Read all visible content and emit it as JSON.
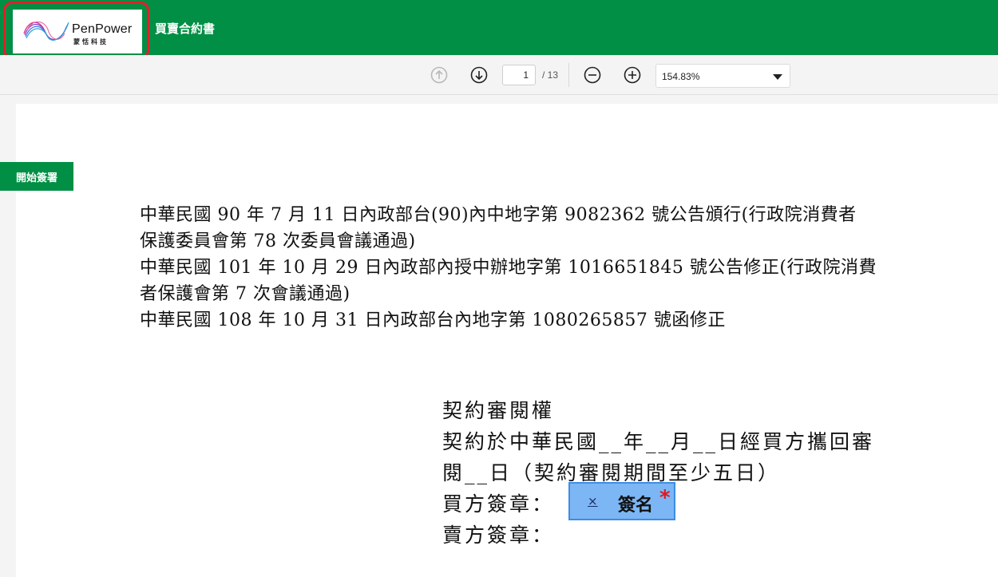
{
  "app": {
    "logo_word": "PenPower",
    "logo_sub": "蒙恬科技",
    "document_title": "買賣合約書",
    "brand_color": "#008f44",
    "highlight_color": "#e41e2b"
  },
  "toolbar": {
    "prev_icon": "arrow-up-circle-icon",
    "next_icon": "arrow-down-circle-icon",
    "page_current": "1",
    "page_total": "/ 13",
    "zoom_out_icon": "minus-circle-icon",
    "zoom_in_icon": "plus-circle-icon",
    "zoom_value": "154.83%"
  },
  "sidebar": {
    "start_sign_label": "開始簽署"
  },
  "document": {
    "lines": [
      "中華民國 90 年 7 月 11 日內政部台(90)內中地字第 9082362 號公告頒行(行政院消費者",
      "保護委員會第 78 次委員會議通過)",
      "中華民國 101 年 10 月 29 日內政部內授中辦地字第 1016651845 號公告修正(行政院消費",
      "者保護會第 7 次會議通過)",
      "中華民國 108 年 10 月 31 日內政部台內地字第 1080265857 號函修正"
    ],
    "review": {
      "heading": "契約審閱權",
      "line1": "契約於中華民國__年__月__日經買方攜回審",
      "line2": "閱__日（契約審閱期間至少五日）",
      "buyer_sign": "買方簽章：",
      "seller_sign": "賣方簽章："
    }
  },
  "signature_field": {
    "remove_label": "×",
    "label": "簽名",
    "required_mark": "*",
    "fill_color": "#7cb6f4"
  }
}
